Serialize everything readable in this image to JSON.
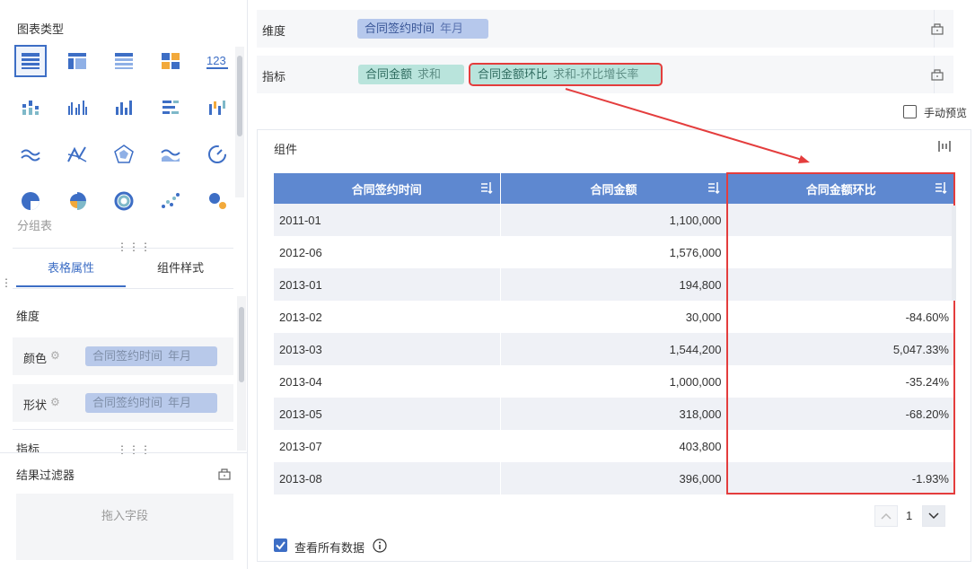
{
  "left_panel": {
    "chart_types_title": "图表类型",
    "group_table_label": "分组表",
    "tabs": [
      {
        "label": "表格属性",
        "active": true
      },
      {
        "label": "组件样式",
        "active": false
      }
    ],
    "dimension_section": "维度",
    "color_row": {
      "label": "颜色",
      "field": "合同签约时间",
      "sub": "年月"
    },
    "shape_row": {
      "label": "形状",
      "field": "合同签约时间",
      "sub": "年月"
    },
    "indicator_section": "指标",
    "filter_title": "结果过滤器",
    "drop_hint": "拖入字段"
  },
  "top_bar": {
    "dimension_label": "维度",
    "dimension_field": {
      "name": "合同签约时间",
      "sub": "年月"
    },
    "indicator_label": "指标",
    "indicator_fields": [
      {
        "name": "合同金额",
        "sub": "求和"
      },
      {
        "name": "合同金额环比",
        "sub": "求和-环比增长率"
      }
    ],
    "manual_preview": "手动预览"
  },
  "component": {
    "title": "组件",
    "columns": [
      "合同签约时间",
      "合同金额",
      "合同金额环比"
    ],
    "rows": [
      [
        "2011-01",
        "1,100,000",
        ""
      ],
      [
        "2012-06",
        "1,576,000",
        ""
      ],
      [
        "2013-01",
        "194,800",
        ""
      ],
      [
        "2013-02",
        "30,000",
        "-84.60%"
      ],
      [
        "2013-03",
        "1,544,200",
        "5,047.33%"
      ],
      [
        "2013-04",
        "1,000,000",
        "-35.24%"
      ],
      [
        "2013-05",
        "318,000",
        "-68.20%"
      ],
      [
        "2013-07",
        "403,800",
        ""
      ],
      [
        "2013-08",
        "396,000",
        "-1.93%"
      ]
    ],
    "page": "1",
    "view_all": "查看所有数据",
    "view_all_checked": true
  },
  "colors": {
    "header": "#5e88d0",
    "highlight": "#e43d3d",
    "accent": "#3d6ec5"
  }
}
